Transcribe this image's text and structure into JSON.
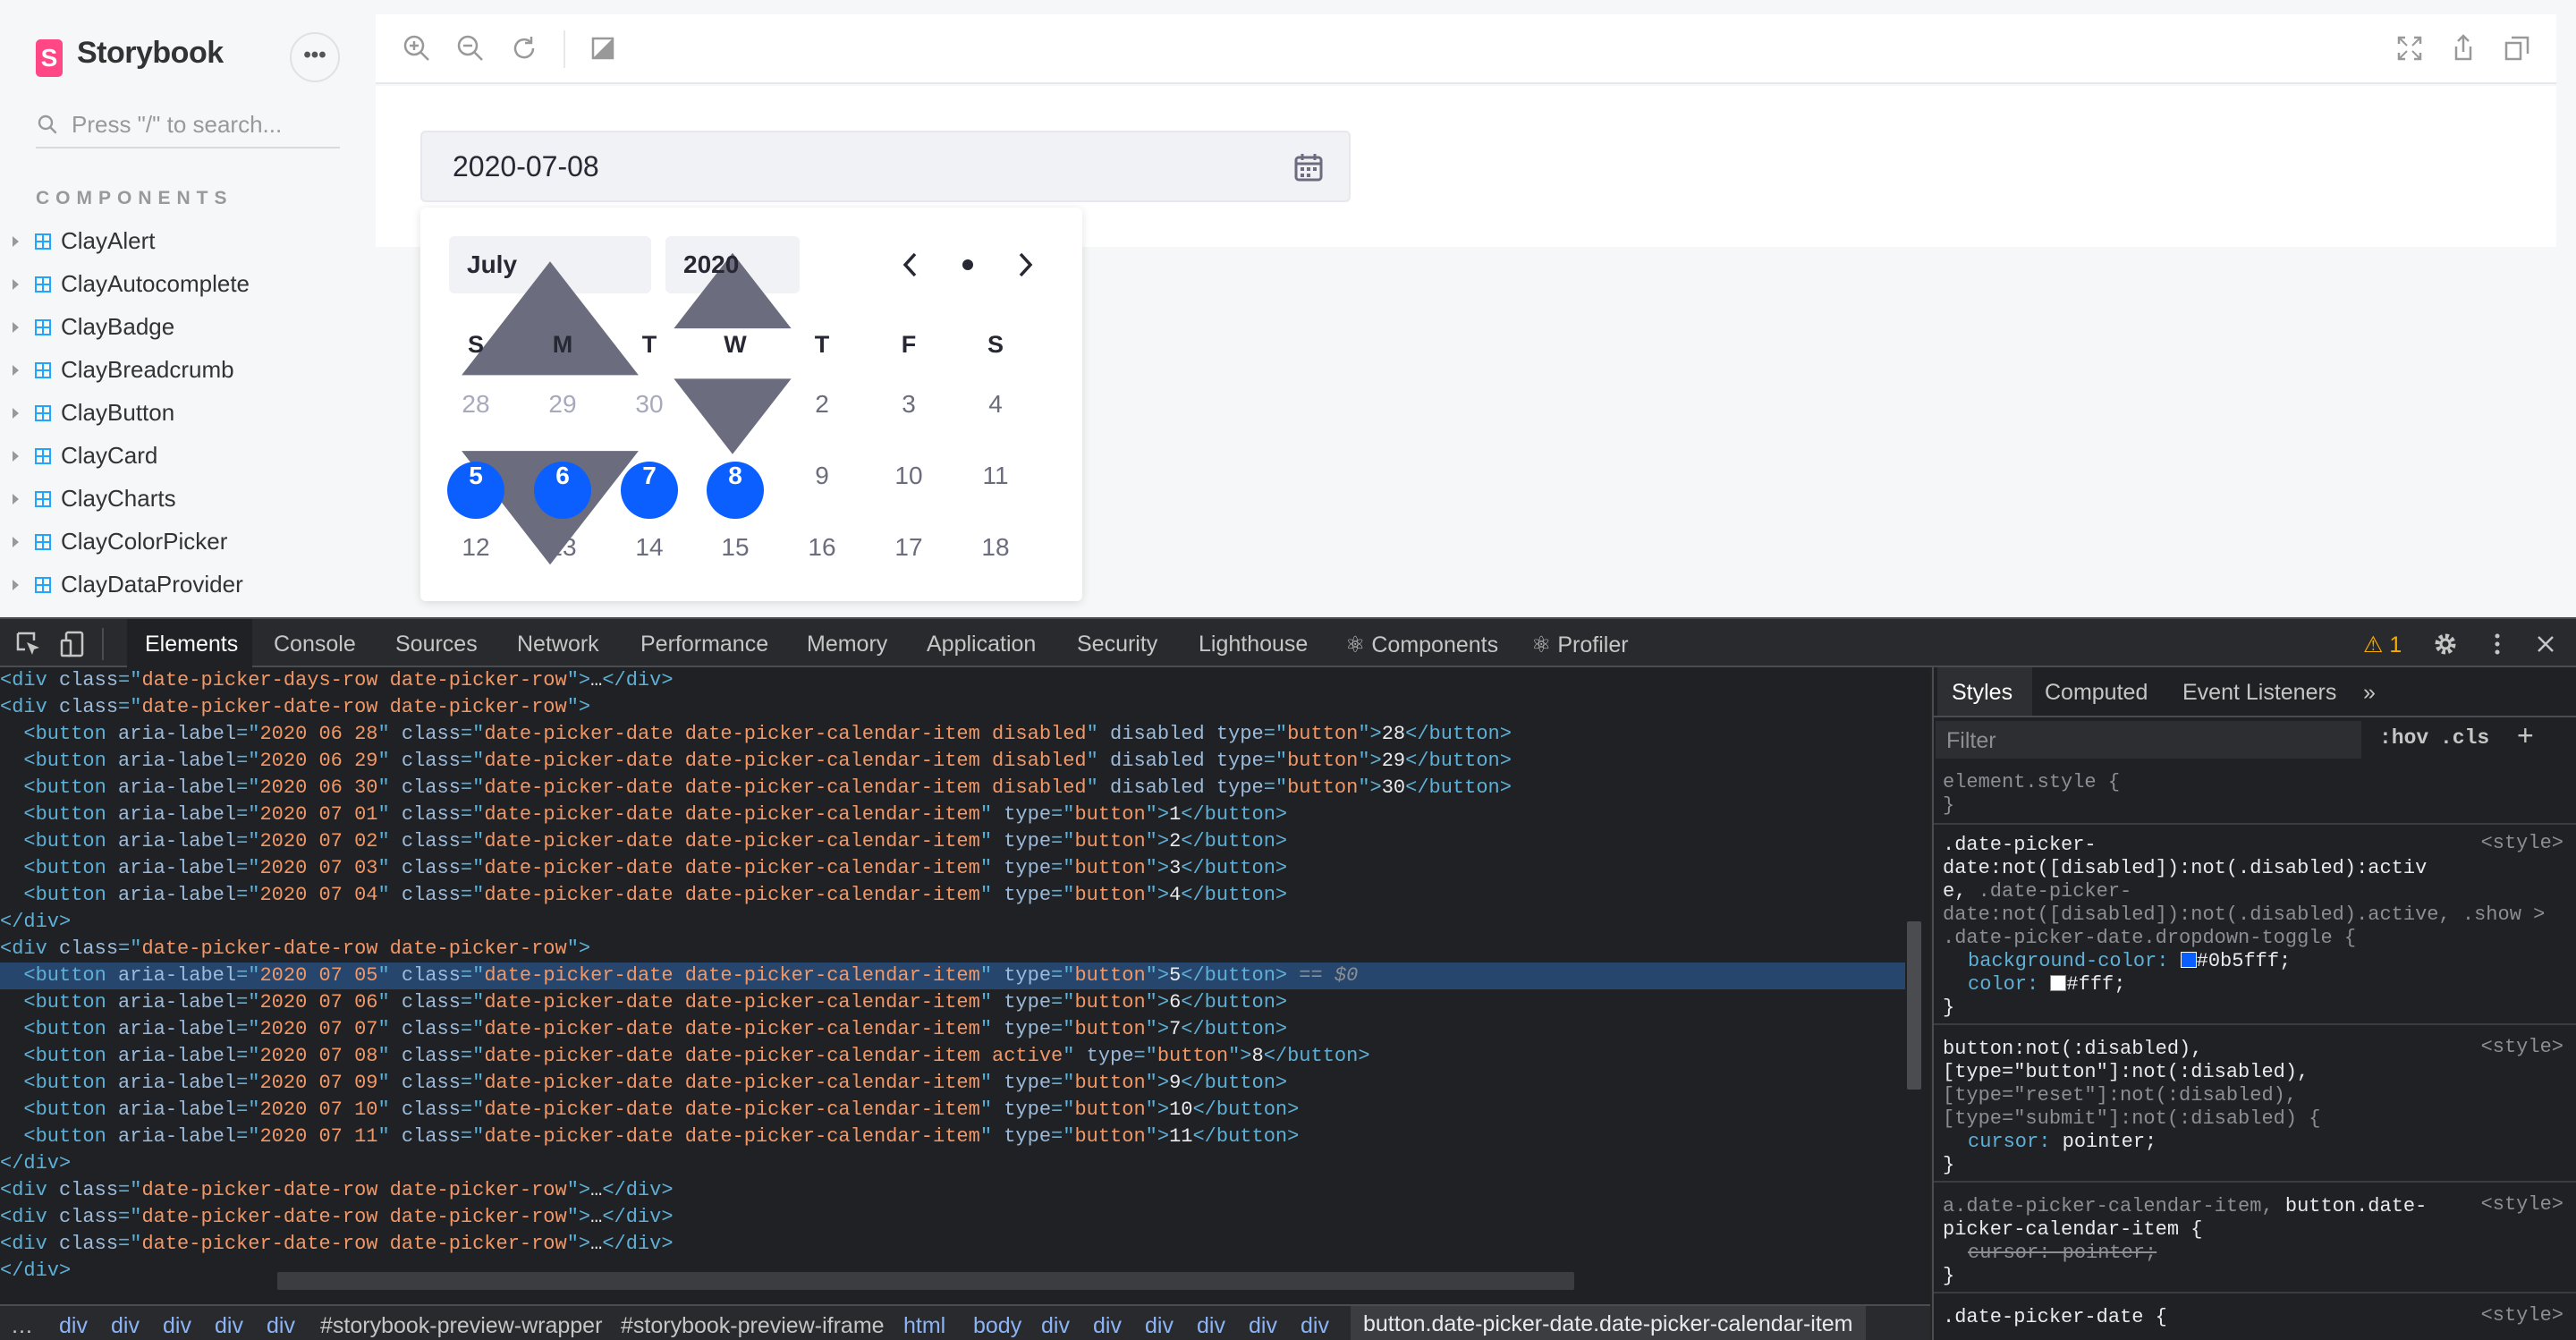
{
  "app": {
    "logo_letter": "S",
    "title": "Storybook",
    "menu_label": "•••"
  },
  "sidebar": {
    "search_placeholder": "Press \"/\" to search...",
    "section": "COMPONENTS",
    "items": [
      "ClayAlert",
      "ClayAutocomplete",
      "ClayBadge",
      "ClayBreadcrumb",
      "ClayButton",
      "ClayCard",
      "ClayCharts",
      "ClayColorPicker",
      "ClayDataProvider"
    ]
  },
  "toolbar": {
    "icons": [
      "zoom-in-icon",
      "zoom-out-icon",
      "reset-zoom-icon",
      "background-icon",
      "fullscreen-icon",
      "share-icon",
      "copy-icon"
    ]
  },
  "datepicker": {
    "value": "2020-07-08",
    "month": "July",
    "year": "2020",
    "prev": "<",
    "dot": "•",
    "next": ">",
    "weekdays": [
      "S",
      "M",
      "T",
      "W",
      "T",
      "F",
      "S"
    ],
    "rows": [
      [
        "28",
        "29",
        "30",
        "1",
        "2",
        "3",
        "4"
      ],
      [
        "5",
        "6",
        "7",
        "8",
        "9",
        "10",
        "11"
      ],
      [
        "12",
        "13",
        "14",
        "15",
        "16",
        "17",
        "18"
      ]
    ],
    "disabled_days": [
      "28",
      "29",
      "30"
    ],
    "active_days": [
      "5",
      "6",
      "7",
      "8"
    ],
    "accent_color": "#0b5fff"
  },
  "devtools": {
    "tabs": [
      "Elements",
      "Console",
      "Sources",
      "Network",
      "Performance",
      "Memory",
      "Application",
      "Security",
      "Lighthouse",
      "⚛ Components",
      "⚛ Profiler"
    ],
    "warning": "⚠ 1",
    "code": [
      "<div class=\"date-picker-days-row date-picker-row\">…</div>",
      "<div class=\"date-picker-date-row date-picker-row\">",
      "  <button aria-label=\"2020 06 28\" class=\"date-picker-date date-picker-calendar-item disabled\" disabled type=\"button\">28</button>",
      "  <button aria-label=\"2020 06 29\" class=\"date-picker-date date-picker-calendar-item disabled\" disabled type=\"button\">29</button>",
      "  <button aria-label=\"2020 06 30\" class=\"date-picker-date date-picker-calendar-item disabled\" disabled type=\"button\">30</button>",
      "  <button aria-label=\"2020 07 01\" class=\"date-picker-date date-picker-calendar-item\" type=\"button\">1</button>",
      "  <button aria-label=\"2020 07 02\" class=\"date-picker-date date-picker-calendar-item\" type=\"button\">2</button>",
      "  <button aria-label=\"2020 07 03\" class=\"date-picker-date date-picker-calendar-item\" type=\"button\">3</button>",
      "  <button aria-label=\"2020 07 04\" class=\"date-picker-date date-picker-calendar-item\" type=\"button\">4</button>",
      "</div>",
      "<div class=\"date-picker-date-row date-picker-row\">",
      "  <button aria-label=\"2020 07 05\" class=\"date-picker-date date-picker-calendar-item\" type=\"button\">5</button> == $0",
      "  <button aria-label=\"2020 07 06\" class=\"date-picker-date date-picker-calendar-item\" type=\"button\">6</button>",
      "  <button aria-label=\"2020 07 07\" class=\"date-picker-date date-picker-calendar-item\" type=\"button\">7</button>",
      "  <button aria-label=\"2020 07 08\" class=\"date-picker-date date-picker-calendar-item active\" type=\"button\">8</button>",
      "  <button aria-label=\"2020 07 09\" class=\"date-picker-date date-picker-calendar-item\" type=\"button\">9</button>",
      "  <button aria-label=\"2020 07 10\" class=\"date-picker-date date-picker-calendar-item\" type=\"button\">10</button>",
      "  <button aria-label=\"2020 07 11\" class=\"date-picker-date date-picker-calendar-item\" type=\"button\">11</button>",
      "</div>",
      "<div class=\"date-picker-date-row date-picker-row\">…</div>",
      "<div class=\"date-picker-date-row date-picker-row\">…</div>",
      "<div class=\"date-picker-date-row date-picker-row\">…</div>",
      "</div>"
    ],
    "selected_line": 11,
    "breadcrumbs": [
      "…",
      "div",
      "div",
      "div",
      "div",
      "div",
      "#storybook-preview-wrapper",
      "#storybook-preview-iframe",
      "html",
      "body",
      "div",
      "div",
      "div",
      "div",
      "div",
      "div"
    ],
    "breadcrumb_last": "button.date-picker-date.date-picker-calendar-item",
    "styles": {
      "tabs": [
        "Styles",
        "Computed",
        "Event Listeners",
        "»"
      ],
      "filter_placeholder": "Filter",
      "hov": ":hov",
      "cls": ".cls",
      "plus": "+",
      "source": "<style>",
      "rules": {
        "element_style": "element.style {",
        "close": "}",
        "r1_sel1": ".date-picker-",
        "r1_sel2": "date:not([disabled]):not(.disabled):activ",
        "r1_sel3a": "e, ",
        "r1_sel3b": ".date-picker-",
        "r1_sel4": "date:not([disabled]):not(.disabled).active, .show >",
        "r1_sel5": ".date-picker-date.dropdown-toggle {",
        "r1_p1": "background-color:",
        "r1_v1": "#0b5fff;",
        "r1_p2": "color:",
        "r1_v2": "#fff;",
        "r2_sel1": "button:not(:disabled),",
        "r2_sel2": "[type=\"button\"]:not(:disabled),",
        "r2_sel3": "[type=\"reset\"]:not(:disabled),",
        "r2_sel4": "[type=\"submit\"]:not(:disabled) {",
        "r2_p1": "cursor:",
        "r2_v1": "pointer;",
        "r3_sel1a": "a.date-picker-calendar-item, ",
        "r3_sel1b": "button.date-",
        "r3_sel2": "picker-calendar-item {",
        "r3_p1": "cursor: pointer;",
        "r4_sel1": ".date-picker-date {"
      }
    }
  }
}
